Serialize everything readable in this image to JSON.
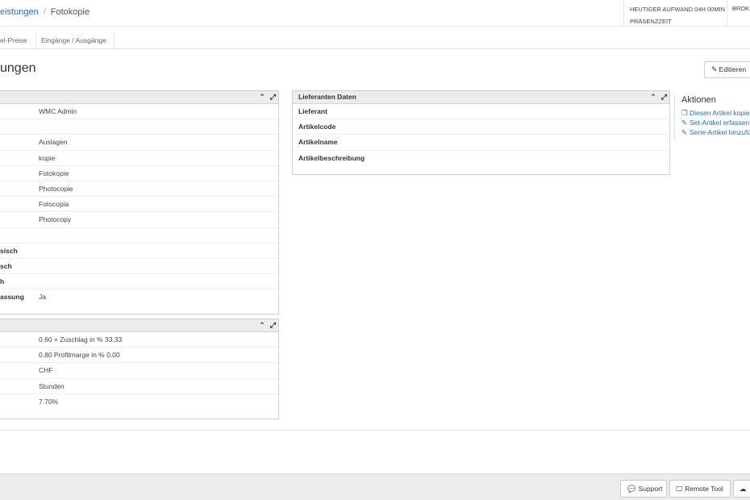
{
  "header": {
    "breadcrumb_link": "eistungen",
    "breadcrumb_sep": "/",
    "breadcrumb_current": "Fotokopie",
    "effort_line1": "HEUTIGER AUFWAND 04H 00MIN",
    "effort_line2": "PRÄSENZZEIT",
    "user": "BROK"
  },
  "tabs": [
    {
      "label": "el-Preise"
    },
    {
      "label": "Eingänge / Ausgänge"
    }
  ],
  "page": {
    "title": "ungen",
    "edit_label": "Editieren"
  },
  "panel_basic": {
    "rows": [
      {
        "label": "",
        "value": "WMC Admin"
      },
      {
        "label": "",
        "value": ""
      },
      {
        "label": "",
        "value": "Auslagen"
      },
      {
        "label": "",
        "value": "kopie"
      },
      {
        "label": "",
        "value": "Fotokopie"
      },
      {
        "label": "",
        "value": "Photocopie"
      },
      {
        "label": "",
        "value": "Fotocopia"
      },
      {
        "label": "",
        "value": "Photocopy"
      },
      {
        "label": "",
        "value": ""
      },
      {
        "label": "sisch",
        "value": ""
      },
      {
        "label": "sch",
        "value": ""
      },
      {
        "label": "h",
        "value": ""
      },
      {
        "label": "assung",
        "value": "Ja"
      }
    ]
  },
  "panel_price": {
    "rows": [
      {
        "label": "",
        "value": "0.60 + Zuschlag in % 33.33"
      },
      {
        "label": "",
        "value": "0.80 Profitmarge in % 0.00"
      },
      {
        "label": "",
        "value": "CHF"
      },
      {
        "label": "",
        "value": "Stunden"
      },
      {
        "label": "",
        "value": "7.70%"
      }
    ]
  },
  "panel_supplier": {
    "title": "Lieferanten Daten",
    "rows": [
      {
        "label": "Lieferant"
      },
      {
        "label": "Artikelcode"
      },
      {
        "label": "Artikelname"
      },
      {
        "label": "Artikelbeschreibung"
      }
    ]
  },
  "actions": {
    "title": "Aktionen",
    "items": [
      {
        "label": "Diesen Artikel kopie",
        "icon": "copy-icon"
      },
      {
        "label": "Set-Artikel erfassen",
        "icon": "edit-icon"
      },
      {
        "label": "Serie-Artikel hinzufü",
        "icon": "edit-icon"
      }
    ]
  },
  "footer": {
    "support_label": "Support",
    "remote_label": "Remote Tool"
  },
  "colors": {
    "link": "#2a6fb5",
    "panel_header": "#ececec",
    "footer_bg": "#ececec"
  }
}
